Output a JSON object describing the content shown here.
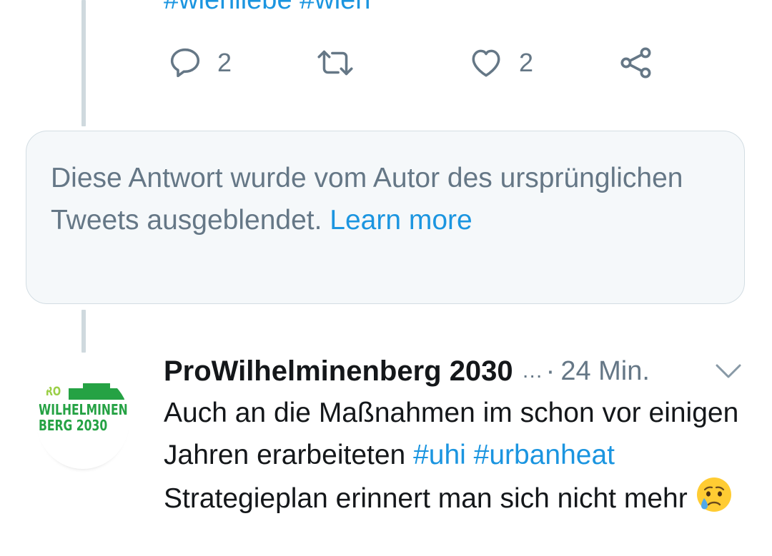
{
  "previous_tweet": {
    "hashtags_line": "#wienliebe #wien",
    "actions": {
      "reply_count": "2",
      "retweet_count": "",
      "like_count": "2"
    }
  },
  "hidden_reply": {
    "message": "Diese Antwort wurde vom Autor des ursprünglichen Tweets ausgeblendet. ",
    "learn_more": "Learn more"
  },
  "tweet": {
    "avatar_text": {
      "line1": "PRO",
      "line2": "WILHELMINEN",
      "line3": "BERG 2030"
    },
    "author_name": "ProWilhelminenberg 2030",
    "ellipsis": "…",
    "separator": "·",
    "time": "24 Min.",
    "text_part1": "Auch an die Maßnahmen im schon vor einigen Jahren erarbeiteten ",
    "hashtag1": "#uhi",
    "hashtag2": "#urbanheat",
    "text_part2": " Strategieplan erinnert man sich nicht mehr ",
    "emoji": "crying-face-emoji"
  },
  "colors": {
    "link_blue": "#1b95e0",
    "secondary_text": "#657786",
    "primary_text": "#14171a",
    "thread_line": "#cfd9de",
    "box_background": "#f5f8fa"
  }
}
